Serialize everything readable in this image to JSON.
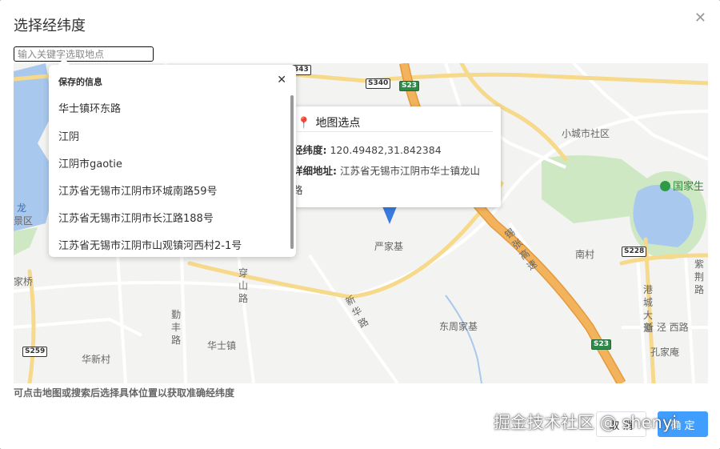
{
  "dialog": {
    "title": "选择经纬度",
    "close_icon": "close-icon"
  },
  "search": {
    "placeholder": "输入关键字选取地点",
    "value": ""
  },
  "saved_panel": {
    "title": "保存的信息",
    "close_icon": "close-icon",
    "items": [
      "华士镇环东路",
      "江阴",
      "江阴市gaotie",
      "江苏省无锡市江阴市环城南路59号",
      "江苏省无锡市江阴市长江路188号",
      "江苏省无锡市江阴市山观镇河西村2-1号"
    ]
  },
  "popup": {
    "icon": "map-pin-icon",
    "title": "地图选点",
    "coords_label": "经纬度:",
    "coords_value": "120.49482,31.842384",
    "address_label": "详细地址:",
    "address_value": "江苏省无锡市江阴市华士镇龙山",
    "address_overflow": "路"
  },
  "map": {
    "labels": {
      "xiaocheng": "小城市社区",
      "park": "国家生",
      "yanjiaji": "严家基",
      "nancun": "南村",
      "dongzhoujiaji": "东周家基",
      "kongjiaan": "孔家庵",
      "huashizhen": "华士镇",
      "huaxincun": "华新村",
      "jiajiaqiao": "家桥",
      "jingqu": "景区",
      "long": "龙",
      "xinjing_xilu": "新 泾 西路",
      "chuanshan_road": "穿山路",
      "qinfeng_road": "勤丰路",
      "xinhua_road": "新华路",
      "gangcheng_road": "港城大道",
      "zijing_road": "紫荆路",
      "highway": "锡张高速"
    },
    "shields": {
      "s340": "S340",
      "s23a": "S23",
      "s23b": "S23",
      "s228": "S228",
      "s259": "S259",
      "s343": "343"
    }
  },
  "hint": "可点击地图或搜索后选择具体位置以获取准确经纬度",
  "buttons": {
    "cancel": "取 消",
    "confirm": "确 定"
  },
  "watermark": "掘金技术社区 @ shenyi",
  "colors": {
    "primary": "#409eff",
    "map_water": "#a9c8ee",
    "map_green": "#cfe8c4",
    "highway": "#f0a84a",
    "pin": "#3a7be0"
  }
}
